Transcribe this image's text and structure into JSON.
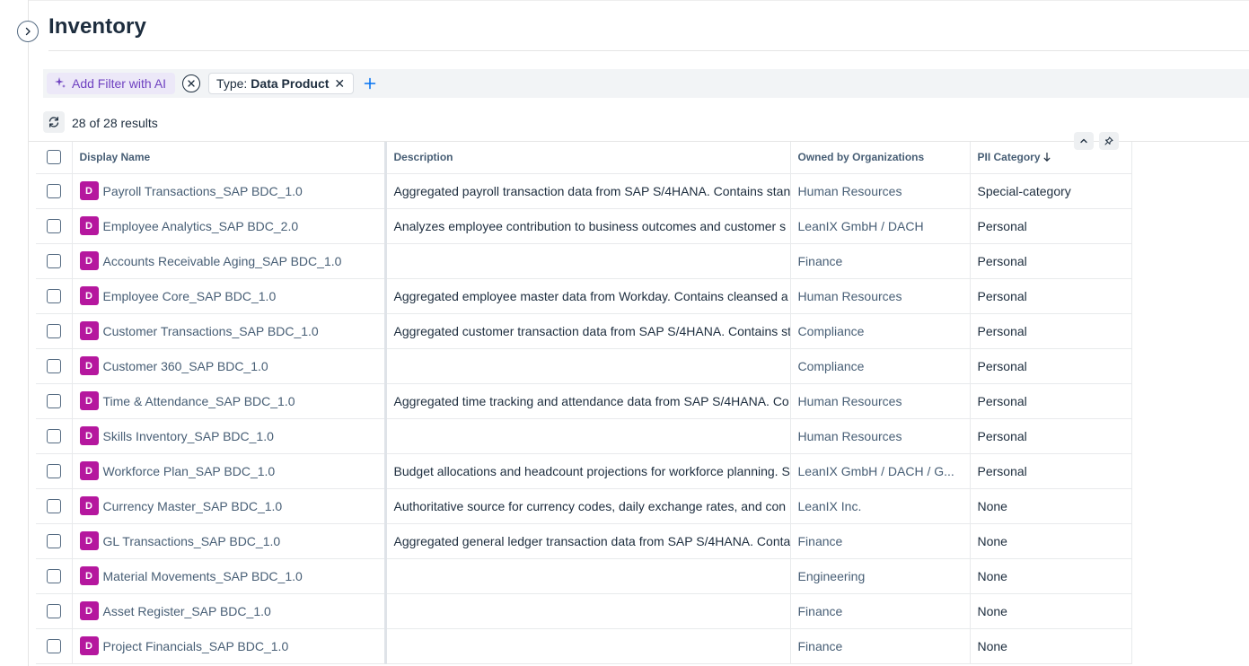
{
  "page": {
    "title": "Inventory"
  },
  "filters": {
    "ai_button_label": "Add Filter with AI",
    "chips": [
      {
        "key": "Type:",
        "value": "Data Product"
      }
    ]
  },
  "results": {
    "count_text": "28 of 28 results"
  },
  "table": {
    "headers": {
      "display_name": "Display Name",
      "description": "Description",
      "owned_by": "Owned by Organizations",
      "pii": "PII Category"
    },
    "rows": [
      {
        "badge": "D",
        "name": "Payroll Transactions_SAP BDC_1.0",
        "description": "Aggregated payroll transaction data from SAP S/4HANA. Contains stan",
        "org": "Human Resources",
        "pii": "Special-category"
      },
      {
        "badge": "D",
        "name": "Employee Analytics_SAP BDC_2.0",
        "description": "Analyzes employee contribution to business outcomes and customer s",
        "org": "LeanIX GmbH / DACH",
        "pii": "Personal"
      },
      {
        "badge": "D",
        "name": "Accounts Receivable Aging_SAP BDC_1.0",
        "description": "",
        "org": "Finance",
        "pii": "Personal"
      },
      {
        "badge": "D",
        "name": "Employee Core_SAP BDC_1.0",
        "description": "Aggregated employee master data from Workday. Contains cleansed a",
        "org": "Human Resources",
        "pii": "Personal"
      },
      {
        "badge": "D",
        "name": "Customer Transactions_SAP BDC_1.0",
        "description": "Aggregated customer transaction data from SAP S/4HANA. Contains st",
        "org": "Compliance",
        "pii": "Personal"
      },
      {
        "badge": "D",
        "name": "Customer 360_SAP BDC_1.0",
        "description": "",
        "org": "Compliance",
        "pii": "Personal"
      },
      {
        "badge": "D",
        "name": "Time & Attendance_SAP BDC_1.0",
        "description": "Aggregated time tracking and attendance data from SAP S/4HANA. Co",
        "org": "Human Resources",
        "pii": "Personal"
      },
      {
        "badge": "D",
        "name": "Skills Inventory_SAP BDC_1.0",
        "description": "",
        "org": "Human Resources",
        "pii": "Personal"
      },
      {
        "badge": "D",
        "name": "Workforce Plan_SAP BDC_1.0",
        "description": "Budget allocations and headcount projections for workforce planning. S",
        "org": "LeanIX GmbH / DACH / G...",
        "pii": "Personal"
      },
      {
        "badge": "D",
        "name": "Currency Master_SAP BDC_1.0",
        "description": "Authoritative source for currency codes, daily exchange rates, and con",
        "org": "LeanIX Inc.",
        "pii": "None"
      },
      {
        "badge": "D",
        "name": "GL Transactions_SAP BDC_1.0",
        "description": "Aggregated general ledger transaction data from SAP S/4HANA. Conta",
        "org": "Finance",
        "pii": "None"
      },
      {
        "badge": "D",
        "name": "Material Movements_SAP BDC_1.0",
        "description": "",
        "org": "Engineering",
        "pii": "None"
      },
      {
        "badge": "D",
        "name": "Asset Register_SAP BDC_1.0",
        "description": "",
        "org": "Finance",
        "pii": "None"
      },
      {
        "badge": "D",
        "name": "Project Financials_SAP BDC_1.0",
        "description": "",
        "org": "Finance",
        "pii": "None"
      }
    ]
  },
  "icons": {
    "expand": "chevron-right-icon",
    "ai": "sparkle-icon",
    "clear": "close-circle-icon",
    "add": "plus-icon",
    "refresh": "refresh-icon",
    "sort": "sort-descending-icon",
    "collapse": "chevron-up-icon",
    "pin": "pin-icon"
  },
  "colors": {
    "badge": "#b5179e",
    "ai_accent": "#6f42c1",
    "link": "#475e75",
    "add_icon": "#0070f2"
  }
}
